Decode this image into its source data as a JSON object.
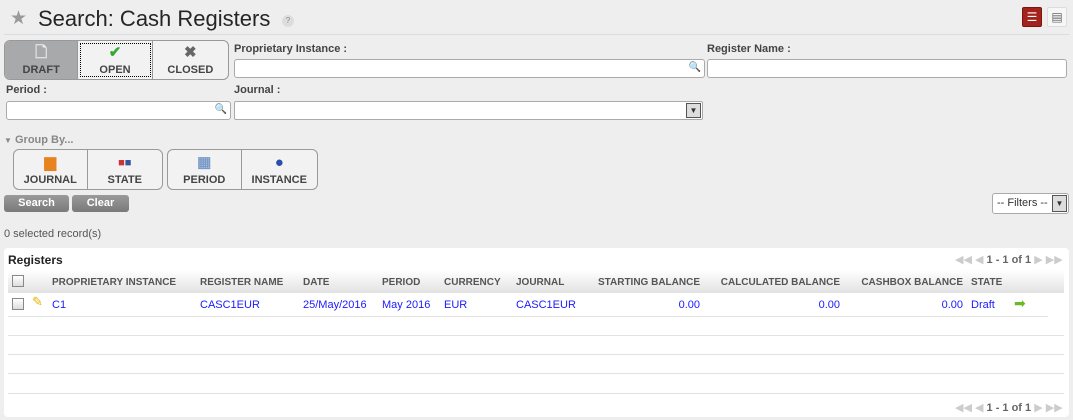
{
  "header": {
    "title": "Search: Cash Registers",
    "help": "?"
  },
  "states": [
    {
      "label": "DRAFT",
      "icon": "draft-doc-icon"
    },
    {
      "label": "OPEN",
      "icon": "check-icon"
    },
    {
      "label": "CLOSED",
      "icon": "x-icon"
    }
  ],
  "fields": {
    "proprietary_instance": {
      "label": "Proprietary Instance :",
      "value": ""
    },
    "register_name": {
      "label": "Register Name :",
      "value": ""
    },
    "period": {
      "label": "Period :",
      "value": ""
    },
    "journal": {
      "label": "Journal :",
      "value": ""
    }
  },
  "group_by": {
    "label": "Group By...",
    "buttons": [
      "JOURNAL",
      "STATE",
      "PERIOD",
      "INSTANCE"
    ]
  },
  "actions": {
    "search": "Search",
    "clear": "Clear",
    "filters": "-- Filters --"
  },
  "selected": "0 selected record(s)",
  "table": {
    "title": "Registers",
    "pager": "1 - 1 of 1",
    "columns": [
      "PROPRIETARY INSTANCE",
      "REGISTER NAME",
      "DATE",
      "PERIOD",
      "CURRENCY",
      "JOURNAL",
      "STARTING BALANCE",
      "CALCULATED BALANCE",
      "CASHBOX BALANCE",
      "STATE"
    ],
    "rows": [
      [
        "C1",
        "CASC1EUR",
        "25/May/2016",
        "May 2016",
        "EUR",
        "CASC1EUR",
        "0.00",
        "0.00",
        "0.00",
        "Draft"
      ]
    ]
  }
}
